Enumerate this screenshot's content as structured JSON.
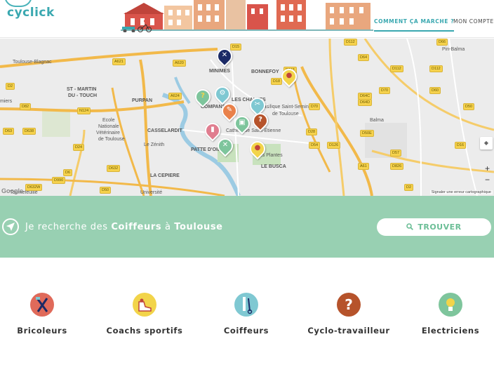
{
  "header": {
    "logo": "cyclick",
    "nav": {
      "how_it_works": "COMMENT ÇA MARCHE ?",
      "account": "MON COMPTE"
    }
  },
  "map": {
    "labels": {
      "toulouse_blagnac": "Toulouse-Blagnac",
      "minimes": "MINIMES",
      "bonnefoy": "BONNEFOY",
      "st_martin": "ST - MARTIN",
      "du_touch": "DU - TOUCH",
      "purpan": "PURPAN",
      "ecole": "Ecole",
      "nationale": "Nationale",
      "veterinaire": "Vétérinaire",
      "de_toulouse": "de Toulouse",
      "casselardit": "CASSELARDIT",
      "zenith": "Le Zénith",
      "la_cepiere": "LA CEPIERE",
      "universite": "Université",
      "patte_doie": "PATTE D'OIE",
      "saint_sernin": "Basilique Saint-Sernin",
      "de_toulouse_2": "de Toulouse",
      "cathedrale": "Cathédrale Saint-Étienne",
      "le_busca": "LE BUSCA",
      "des_plantes": "des Plantes",
      "balma": "Balma",
      "pin_balma": "Pin-Balma",
      "miers": "miers",
      "tournefeuille": "Tournefeuille",
      "les_chalets": "LES CHALETS",
      "compans": "COMPANS",
      "google": "Google",
      "report": "Signaler une erreur cartographique"
    },
    "roads": [
      "D1",
      "D15",
      "D112",
      "D64",
      "D66",
      "A621",
      "A620",
      "D2",
      "A624",
      "N124",
      "D82",
      "D63",
      "D638",
      "D24",
      "D632",
      "D6",
      "D632",
      "D990",
      "D632W",
      "D50",
      "A620",
      "D18",
      "D112",
      "D70",
      "D64C",
      "D64D",
      "D70",
      "D60",
      "D50",
      "D50E",
      "D57",
      "D126",
      "D826",
      "A61",
      "D2",
      "D16",
      "D28",
      "D54",
      "D70",
      "D112"
    ],
    "zoom_in": "+",
    "zoom_out": "−"
  },
  "search": {
    "prefix": "Je recherche des",
    "category": "Coiffeurs",
    "preposition": "à",
    "city": "Toulouse",
    "button": "TROUVER"
  },
  "categories": [
    {
      "label": "Bricoleurs",
      "color": "#e06a5a"
    },
    {
      "label": "Coachs sportifs",
      "color": "#f2d44a"
    },
    {
      "label": "Coiffeurs",
      "color": "#7fc8d2"
    },
    {
      "label": "Cyclo-travailleur",
      "color": "#b6532b"
    },
    {
      "label": "Electriciens",
      "color": "#7ec59c"
    }
  ],
  "colors": {
    "accent": "#3aa8b0",
    "band": "#98d0b2",
    "button_text": "#6bbe96"
  }
}
